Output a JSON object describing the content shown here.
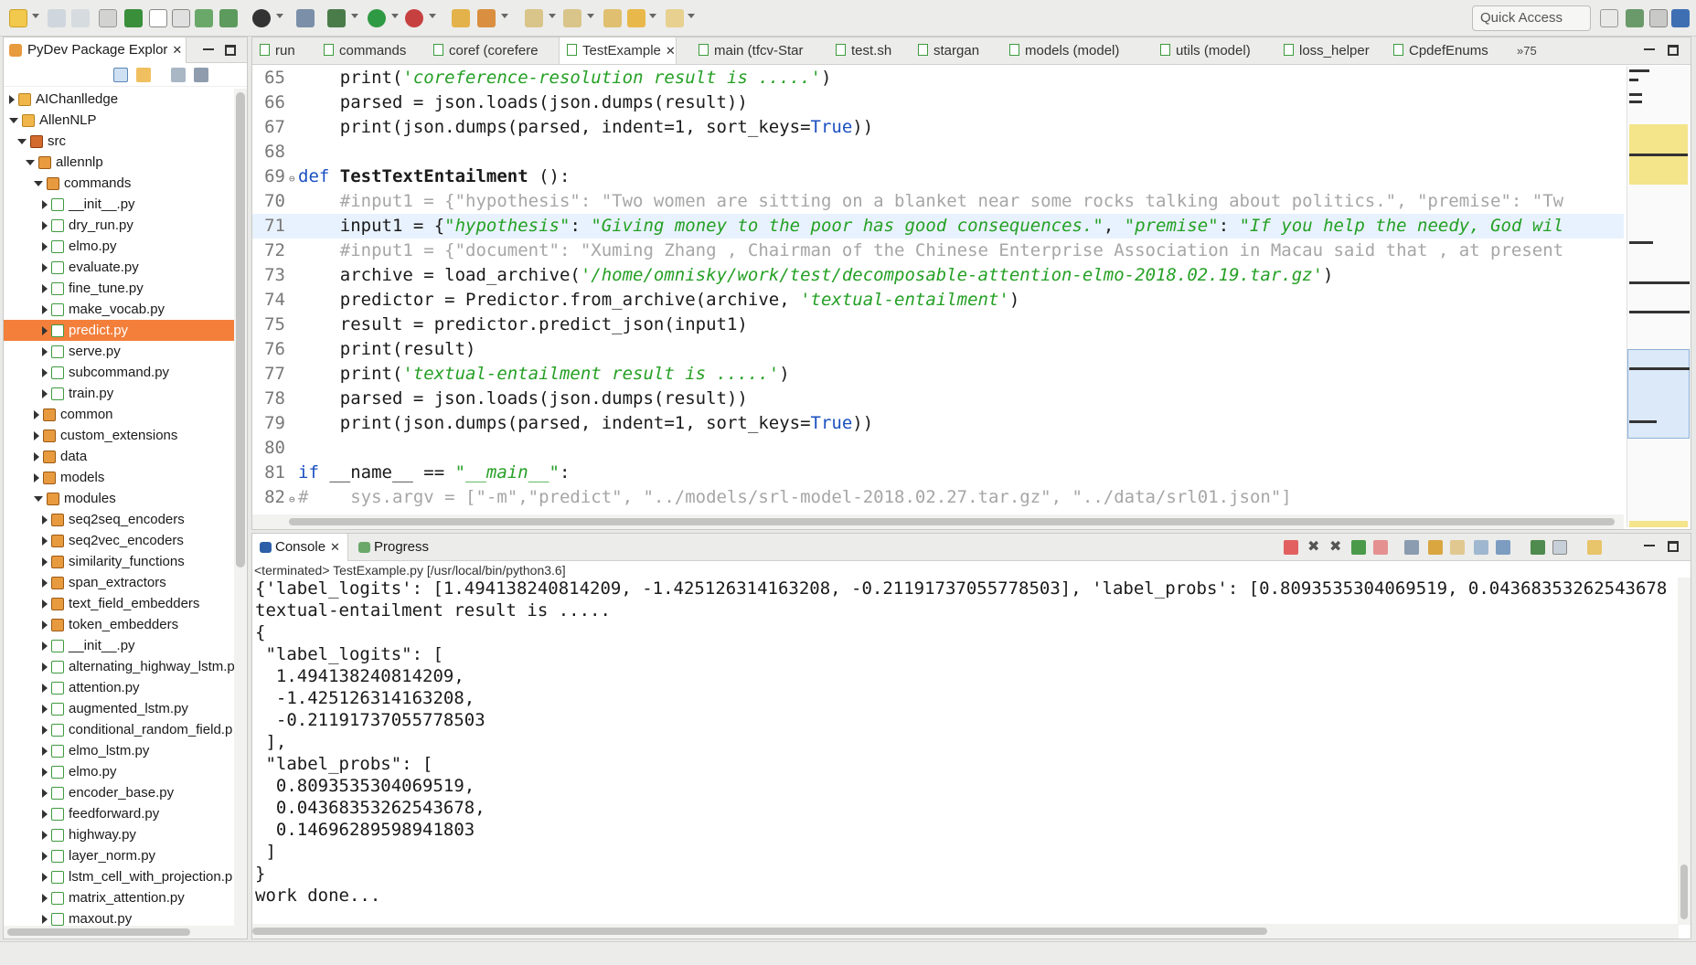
{
  "toolbar": {
    "quick_access": "Quick Access"
  },
  "package_explorer": {
    "title": "PyDev Package Explor",
    "tree": [
      {
        "label": "AIChanlledge",
        "indent": 0,
        "icon": "proj",
        "state": "c",
        "selected": false
      },
      {
        "label": "AllenNLP",
        "indent": 0,
        "icon": "proj",
        "state": "o",
        "selected": false
      },
      {
        "label": "src",
        "indent": 1,
        "icon": "src",
        "state": "o",
        "selected": false
      },
      {
        "label": "allennlp",
        "indent": 2,
        "icon": "pkg",
        "state": "o",
        "selected": false
      },
      {
        "label": "commands",
        "indent": 3,
        "icon": "pkg",
        "state": "o",
        "selected": false
      },
      {
        "label": "__init__.py",
        "indent": 4,
        "icon": "file",
        "state": "c",
        "selected": false
      },
      {
        "label": "dry_run.py",
        "indent": 4,
        "icon": "file",
        "state": "c",
        "selected": false
      },
      {
        "label": "elmo.py",
        "indent": 4,
        "icon": "file",
        "state": "c",
        "selected": false
      },
      {
        "label": "evaluate.py",
        "indent": 4,
        "icon": "file",
        "state": "c",
        "selected": false
      },
      {
        "label": "fine_tune.py",
        "indent": 4,
        "icon": "file",
        "state": "c",
        "selected": false
      },
      {
        "label": "make_vocab.py",
        "indent": 4,
        "icon": "file",
        "state": "c",
        "selected": false
      },
      {
        "label": "predict.py",
        "indent": 4,
        "icon": "file",
        "state": "c",
        "selected": true
      },
      {
        "label": "serve.py",
        "indent": 4,
        "icon": "file",
        "state": "c",
        "selected": false
      },
      {
        "label": "subcommand.py",
        "indent": 4,
        "icon": "file",
        "state": "c",
        "selected": false
      },
      {
        "label": "train.py",
        "indent": 4,
        "icon": "file",
        "state": "c",
        "selected": false
      },
      {
        "label": "common",
        "indent": 3,
        "icon": "pkg",
        "state": "c",
        "selected": false
      },
      {
        "label": "custom_extensions",
        "indent": 3,
        "icon": "pkg",
        "state": "c",
        "selected": false
      },
      {
        "label": "data",
        "indent": 3,
        "icon": "pkg",
        "state": "c",
        "selected": false
      },
      {
        "label": "models",
        "indent": 3,
        "icon": "pkg",
        "state": "c",
        "selected": false
      },
      {
        "label": "modules",
        "indent": 3,
        "icon": "pkg",
        "state": "o",
        "selected": false
      },
      {
        "label": "seq2seq_encoders",
        "indent": 4,
        "icon": "pkg",
        "state": "c",
        "selected": false
      },
      {
        "label": "seq2vec_encoders",
        "indent": 4,
        "icon": "pkg",
        "state": "c",
        "selected": false
      },
      {
        "label": "similarity_functions",
        "indent": 4,
        "icon": "pkg",
        "state": "c",
        "selected": false
      },
      {
        "label": "span_extractors",
        "indent": 4,
        "icon": "pkg",
        "state": "c",
        "selected": false
      },
      {
        "label": "text_field_embedders",
        "indent": 4,
        "icon": "pkg",
        "state": "c",
        "selected": false
      },
      {
        "label": "token_embedders",
        "indent": 4,
        "icon": "pkg",
        "state": "c",
        "selected": false
      },
      {
        "label": "__init__.py",
        "indent": 4,
        "icon": "file",
        "state": "c",
        "selected": false
      },
      {
        "label": "alternating_highway_lstm.p",
        "indent": 4,
        "icon": "file",
        "state": "c",
        "selected": false
      },
      {
        "label": "attention.py",
        "indent": 4,
        "icon": "file",
        "state": "c",
        "selected": false
      },
      {
        "label": "augmented_lstm.py",
        "indent": 4,
        "icon": "file",
        "state": "c",
        "selected": false
      },
      {
        "label": "conditional_random_field.p",
        "indent": 4,
        "icon": "file",
        "state": "c",
        "selected": false
      },
      {
        "label": "elmo_lstm.py",
        "indent": 4,
        "icon": "file",
        "state": "c",
        "selected": false
      },
      {
        "label": "elmo.py",
        "indent": 4,
        "icon": "file",
        "state": "c",
        "selected": false
      },
      {
        "label": "encoder_base.py",
        "indent": 4,
        "icon": "file",
        "state": "c",
        "selected": false
      },
      {
        "label": "feedforward.py",
        "indent": 4,
        "icon": "file",
        "state": "c",
        "selected": false
      },
      {
        "label": "highway.py",
        "indent": 4,
        "icon": "file",
        "state": "c",
        "selected": false
      },
      {
        "label": "layer_norm.py",
        "indent": 4,
        "icon": "file",
        "state": "c",
        "selected": false
      },
      {
        "label": "lstm_cell_with_projection.p",
        "indent": 4,
        "icon": "file",
        "state": "c",
        "selected": false
      },
      {
        "label": "matrix_attention.py",
        "indent": 4,
        "icon": "file",
        "state": "c",
        "selected": false
      },
      {
        "label": "maxout.py",
        "indent": 4,
        "icon": "file",
        "state": "c",
        "selected": false
      }
    ]
  },
  "editor": {
    "tabs": [
      {
        "label": "run",
        "active": false,
        "closable": false
      },
      {
        "label": "commands",
        "active": false,
        "closable": false
      },
      {
        "label": "coref (corefere",
        "active": false,
        "closable": false
      },
      {
        "label": "TestExample",
        "active": true,
        "closable": true
      },
      {
        "label": "main (tfcv-Star",
        "active": false,
        "closable": false
      },
      {
        "label": "test.sh",
        "active": false,
        "closable": false
      },
      {
        "label": "stargan",
        "active": false,
        "closable": false
      },
      {
        "label": "models (model)",
        "active": false,
        "closable": false
      },
      {
        "label": "utils (model)",
        "active": false,
        "closable": false
      },
      {
        "label": "loss_helper",
        "active": false,
        "closable": false
      },
      {
        "label": "CpdefEnums",
        "active": false,
        "closable": false
      }
    ],
    "overflow": "»75",
    "lines": [
      {
        "num": "65",
        "hl": false,
        "fold": false,
        "tokens": [
          [
            "t",
            "    "
          ],
          [
            "t",
            "print("
          ],
          [
            "s",
            "'coreference-resolution result is .....'"
          ],
          [
            "t",
            ")"
          ]
        ]
      },
      {
        "num": "66",
        "hl": false,
        "fold": false,
        "tokens": [
          [
            "t",
            "    parsed = json.loads(json.dumps(result))"
          ]
        ]
      },
      {
        "num": "67",
        "hl": false,
        "fold": false,
        "tokens": [
          [
            "t",
            "    print(json.dumps(parsed, indent=1, sort_keys="
          ],
          [
            "l",
            "True"
          ],
          [
            "t",
            "))"
          ]
        ]
      },
      {
        "num": "68",
        "hl": false,
        "fold": false,
        "tokens": [
          [
            "t",
            ""
          ]
        ]
      },
      {
        "num": "69",
        "hl": false,
        "fold": true,
        "tokens": [
          [
            "k",
            "def "
          ],
          [
            "f",
            "TestTextEntailment"
          ],
          [
            "t",
            " ():"
          ]
        ]
      },
      {
        "num": "70",
        "hl": false,
        "fold": false,
        "tokens": [
          [
            "c",
            "    #input1 = {\"hypothesis\": \"Two women are sitting on a blanket near some rocks talking about politics.\", \"premise\": \"Tw"
          ]
        ]
      },
      {
        "num": "71",
        "hl": true,
        "fold": false,
        "tokens": [
          [
            "t",
            "    input1 = {"
          ],
          [
            "s",
            "\"hypothesis\""
          ],
          [
            "t",
            ": "
          ],
          [
            "s",
            "\"Giving money to the poor has good consequences.\""
          ],
          [
            "t",
            ", "
          ],
          [
            "s",
            "\"premise\""
          ],
          [
            "t",
            ": "
          ],
          [
            "s",
            "\"If you help the needy, God wil"
          ]
        ]
      },
      {
        "num": "72",
        "hl": false,
        "fold": false,
        "tokens": [
          [
            "c",
            "    #input1 = {\"document\": \"Xuming Zhang , Chairman of the Chinese Enterprise Association in Macau said that , at present"
          ]
        ]
      },
      {
        "num": "73",
        "hl": false,
        "fold": false,
        "tokens": [
          [
            "t",
            "    archive = load_archive("
          ],
          [
            "s",
            "'/home/omnisky/work/test/decomposable-attention-elmo-2018.02.19.tar.gz'"
          ],
          [
            "t",
            ")"
          ]
        ]
      },
      {
        "num": "74",
        "hl": false,
        "fold": false,
        "tokens": [
          [
            "t",
            "    predictor = Predictor.from_archive(archive, "
          ],
          [
            "s",
            "'textual-entailment'"
          ],
          [
            "t",
            ")"
          ]
        ]
      },
      {
        "num": "75",
        "hl": false,
        "fold": false,
        "tokens": [
          [
            "t",
            "    result = predictor.predict_json(input1)"
          ]
        ]
      },
      {
        "num": "76",
        "hl": false,
        "fold": false,
        "tokens": [
          [
            "t",
            "    print(result)"
          ]
        ]
      },
      {
        "num": "77",
        "hl": false,
        "fold": false,
        "tokens": [
          [
            "t",
            "    print("
          ],
          [
            "s",
            "'textual-entailment result is .....'"
          ],
          [
            "t",
            ")"
          ]
        ]
      },
      {
        "num": "78",
        "hl": false,
        "fold": false,
        "tokens": [
          [
            "t",
            "    parsed = json.loads(json.dumps(result))"
          ]
        ]
      },
      {
        "num": "79",
        "hl": false,
        "fold": false,
        "tokens": [
          [
            "t",
            "    print(json.dumps(parsed, indent=1, sort_keys="
          ],
          [
            "l",
            "True"
          ],
          [
            "t",
            "))"
          ]
        ]
      },
      {
        "num": "80",
        "hl": false,
        "fold": false,
        "tokens": [
          [
            "t",
            ""
          ]
        ]
      },
      {
        "num": "81",
        "hl": false,
        "fold": false,
        "tokens": [
          [
            "k",
            "if "
          ],
          [
            "t",
            "__name__ == "
          ],
          [
            "s",
            "\"__main__\""
          ],
          [
            "t",
            ":"
          ]
        ]
      },
      {
        "num": "82",
        "hl": false,
        "fold": true,
        "tokens": [
          [
            "c",
            "#    sys.argv = [\"-m\",\"predict\", \"../models/srl-model-2018.02.27.tar.gz\", \"../data/srl01.json\"]"
          ]
        ]
      }
    ]
  },
  "console": {
    "tabs": [
      {
        "label": "Console",
        "active": true
      },
      {
        "label": "Progress",
        "active": false
      }
    ],
    "status": "<terminated> TestExample.py [/usr/local/bin/python3.6]",
    "lines": [
      "{'label_logits': [1.494138240814209, -1.425126314163208, -0.21191737055778503], 'label_probs': [0.8093535304069519, 0.04368353262543678",
      "textual-entailment result is .....",
      "{",
      " \"label_logits\": [",
      "  1.494138240814209,",
      "  -1.425126314163208,",
      "  -0.21191737055778503",
      " ],",
      " \"label_probs\": [",
      "  0.8093535304069519,",
      "  0.04368353262543678,",
      "  0.14696289598941803",
      " ]",
      "}",
      "work done..."
    ]
  },
  "colors": {
    "selection": "#f37f3b",
    "keyword": "#1a4fc1",
    "string": "#25a025",
    "comment": "#a6a6a6",
    "current_line": "#e8f2fe"
  }
}
